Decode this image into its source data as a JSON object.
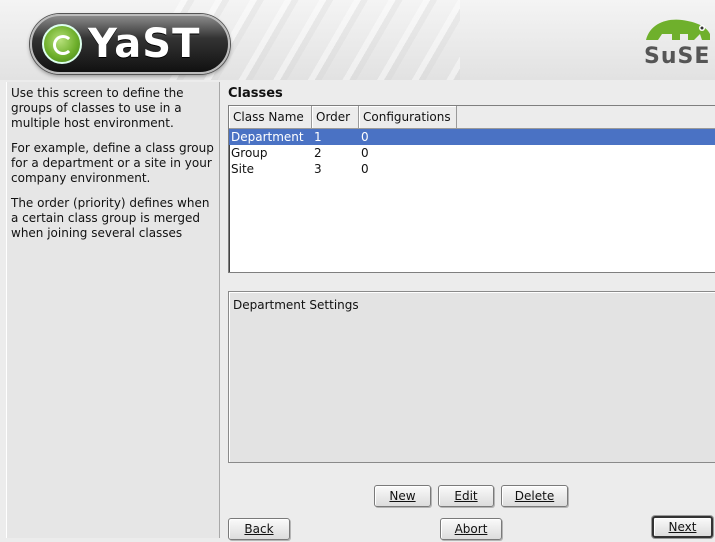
{
  "banner": {
    "logo_text": "YaST",
    "brand_text": "SuSE"
  },
  "help": {
    "paragraphs": [
      "Use this screen to define the groups of classes to use in a multiple host environment.",
      "For example, define a class group for a department or a site in your company environment.",
      "The order (priority) defines when a certain class group is merged when joining several classes"
    ]
  },
  "main": {
    "title": "Classes",
    "table": {
      "columns": [
        "Class Name",
        "Order",
        "Configurations"
      ],
      "rows": [
        {
          "name": "Department",
          "order": "1",
          "configurations": "0",
          "selected": true
        },
        {
          "name": "Group",
          "order": "2",
          "configurations": "0",
          "selected": false
        },
        {
          "name": "Site",
          "order": "3",
          "configurations": "0",
          "selected": false
        }
      ]
    },
    "settings_label": "Department Settings"
  },
  "buttons": {
    "new": "New",
    "edit": "Edit",
    "delete": "Delete",
    "back": "Back",
    "abort": "Abort",
    "next": "Next"
  },
  "colors": {
    "selection": "#4a72c4",
    "logo_green": "#6fb02c"
  }
}
